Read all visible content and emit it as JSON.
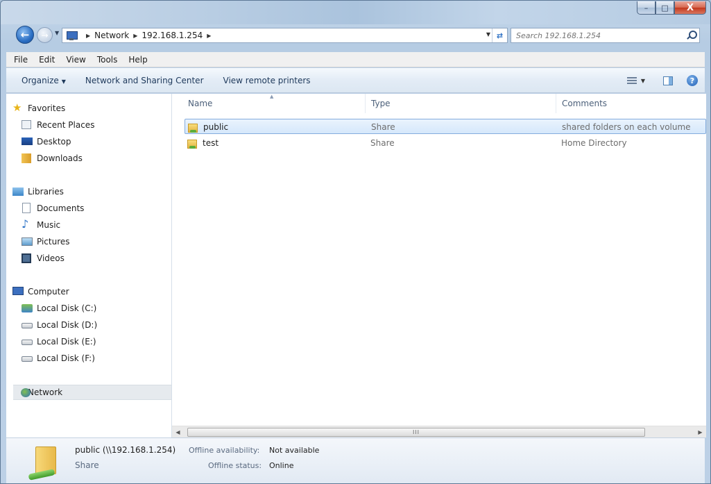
{
  "titlebar": {
    "minimize_glyph": "–",
    "maximize_glyph": "□",
    "close_glyph": "X"
  },
  "address": {
    "crumbs": [
      "Network",
      "192.168.1.254"
    ],
    "search_placeholder": "Search 192.168.1.254"
  },
  "menu": [
    "File",
    "Edit",
    "View",
    "Tools",
    "Help"
  ],
  "commands": {
    "organize": "Organize",
    "network_sharing": "Network and Sharing Center",
    "remote_printers": "View remote printers"
  },
  "nav": {
    "favorites": {
      "label": "Favorites",
      "items": [
        "Recent Places",
        "Desktop",
        "Downloads"
      ]
    },
    "libraries": {
      "label": "Libraries",
      "items": [
        "Documents",
        "Music",
        "Pictures",
        "Videos"
      ]
    },
    "computer": {
      "label": "Computer",
      "items": [
        "Local Disk (C:)",
        "Local Disk (D:)",
        "Local Disk (E:)",
        "Local Disk (F:)"
      ]
    },
    "network": {
      "label": "Network"
    }
  },
  "columns": {
    "name": "Name",
    "type": "Type",
    "comments": "Comments"
  },
  "rows": [
    {
      "name": "public",
      "type": "Share",
      "comments": "shared folders on each volume",
      "selected": true
    },
    {
      "name": "test",
      "type": "Share",
      "comments": "Home Directory",
      "selected": false
    }
  ],
  "scroll": {
    "grip": "III"
  },
  "details": {
    "title": "public (\\\\192.168.1.254)",
    "type": "Share",
    "offline_availability_label": "Offline availability:",
    "offline_availability_value": "Not available",
    "offline_status_label": "Offline status:",
    "offline_status_value": "Online"
  },
  "colors": {
    "selection_fill": "#d6e8fb",
    "selection_border": "#84acdd",
    "command_text": "#1e395b"
  }
}
